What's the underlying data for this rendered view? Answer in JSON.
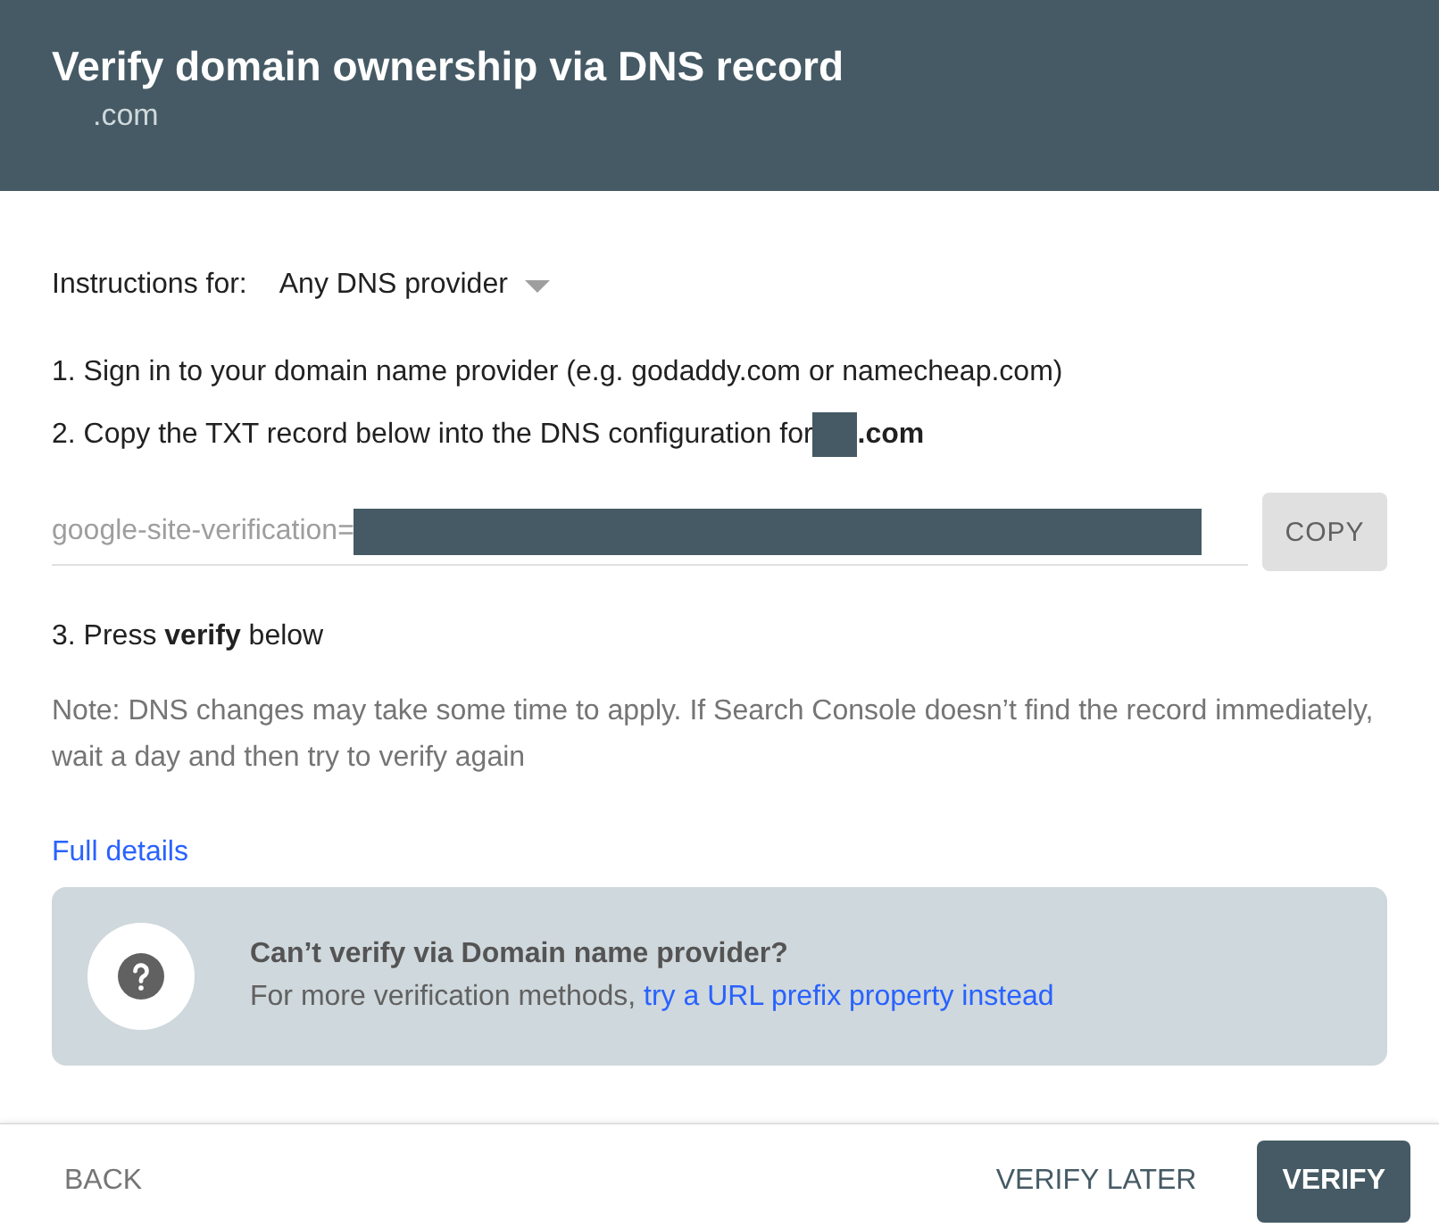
{
  "header": {
    "title": "Verify domain ownership via DNS record",
    "subtitle": ".com"
  },
  "instructions": {
    "label": "Instructions for:",
    "provider": "Any DNS provider"
  },
  "steps": [
    {
      "kind": "text",
      "text": "1. Sign in to your domain name provider (e.g. godaddy.com or namecheap.com)"
    },
    {
      "kind": "domain",
      "text": "2. Copy the TXT record below into the DNS configuration for",
      "suffix": ".com"
    }
  ],
  "record": {
    "value": "google-site-verification=",
    "button": "COPY"
  },
  "step3": "3. Press **verify** below",
  "note": "Note: DNS changes may take some time to apply. If Search Console doesn’t find the record immediately, wait a day and then try to verify again",
  "details_link": "Full details",
  "callout": {
    "title": "Can’t verify via Domain name provider?",
    "text": "For more verification methods,",
    "link": "try a URL prefix property instead"
  },
  "footer": {
    "back": "BACK",
    "later": "VERIFY LATER",
    "verify": "VERIFY"
  }
}
